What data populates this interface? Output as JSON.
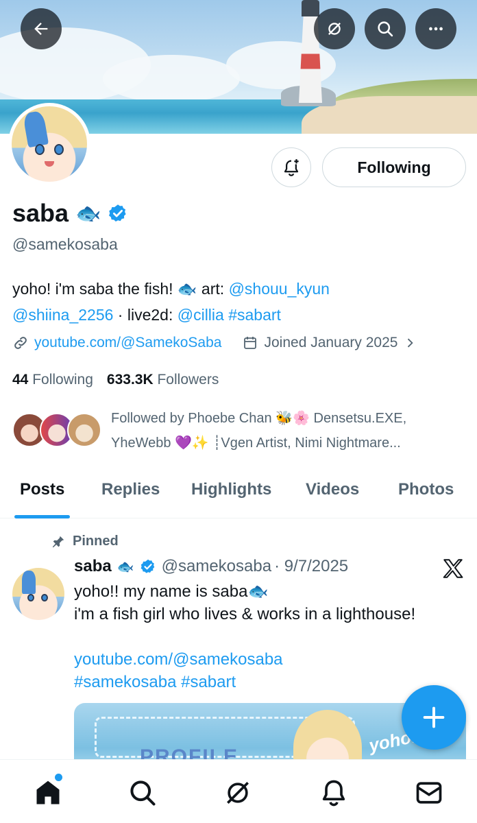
{
  "header": {
    "back_icon": "arrow-left-icon",
    "grok_icon": "grok-icon",
    "search_icon": "search-icon",
    "more_icon": "more-dots-icon"
  },
  "profile": {
    "display_name": "saba",
    "emoji": "🐟",
    "handle": "@samekosaba",
    "following_label": "Following",
    "bio": {
      "line1_text": "yoho! i'm saba the fish! 🐟 art: ",
      "art_link1": "@shouu_kyun",
      "art_link2": "@shiina_2256",
      "sep": " · live2d: ",
      "live2d_link": "@cillia",
      "hashtag": "#sabart"
    },
    "website": "youtube.com/@SamekoSaba",
    "joined": "Joined January 2025",
    "following_count": "44",
    "following_text": "Following",
    "followers_count": "633.3K",
    "followers_text": "Followers",
    "followed_by": "Followed by Phoebe Chan 🐝🌸 Densetsu.EXE, YheWebb 💜✨ ┊Vgen Artist, Nimi Nightmare..."
  },
  "tabs": [
    {
      "label": "Posts",
      "active": true
    },
    {
      "label": "Replies"
    },
    {
      "label": "Highlights"
    },
    {
      "label": "Videos"
    },
    {
      "label": "Photos"
    }
  ],
  "post": {
    "pinned_label": "Pinned",
    "author_name": "saba",
    "author_emoji": "🐟",
    "author_handle": "@samekosaba",
    "date": "· 9/7/2025",
    "line1": "yoho!! my name is saba🐟",
    "line2": "i'm a fish girl who lives & works in a lighthouse!",
    "link": "youtube.com/@samekosaba",
    "hashtags": "#samekosaba #sabart",
    "media_text": "PROFILE",
    "media_yoho": "yoho!"
  },
  "colors": {
    "accent": "#1d9bf0",
    "text": "#0f1419",
    "muted": "#536471"
  },
  "bottom_nav": [
    "home-icon",
    "search-icon",
    "grok-icon",
    "notifications-icon",
    "messages-icon"
  ]
}
